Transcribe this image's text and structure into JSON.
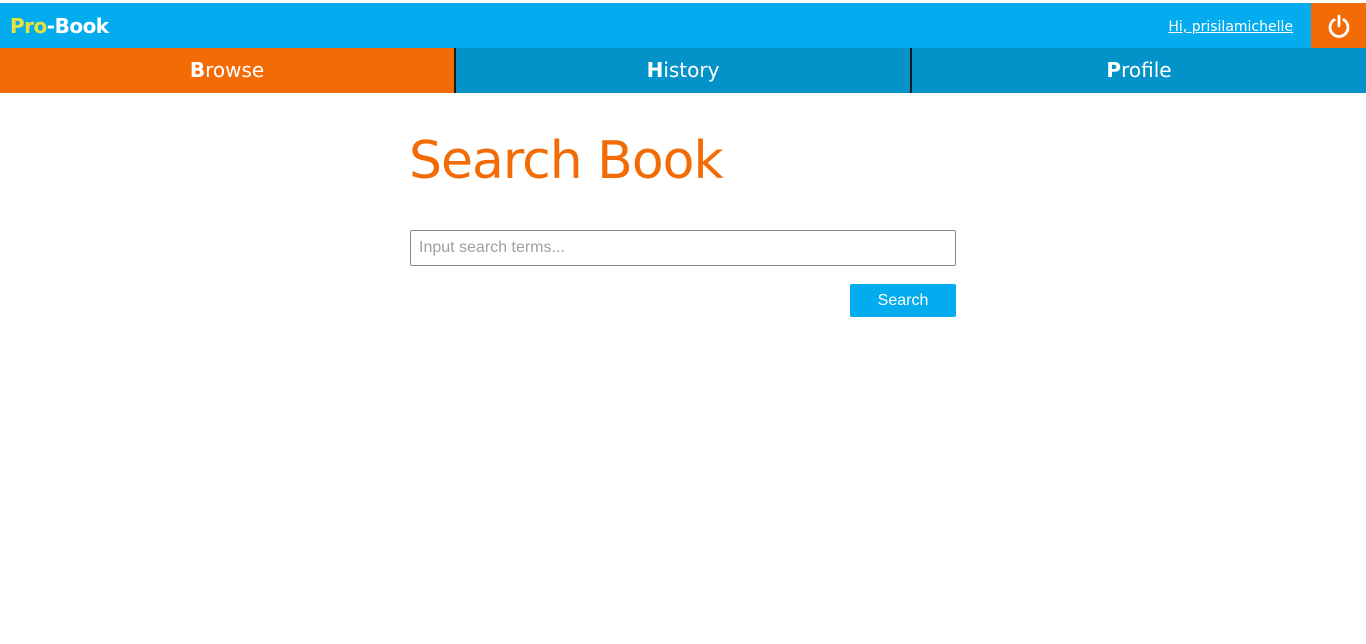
{
  "header": {
    "logo": {
      "pro": "Pro",
      "dash": "-",
      "book": "Book"
    },
    "greeting": "Hi, prisilamichelle",
    "logout_icon": "power-icon"
  },
  "nav": {
    "tabs": [
      {
        "initial": "B",
        "rest": "rowse",
        "active": true
      },
      {
        "initial": "H",
        "rest": "istory",
        "active": false
      },
      {
        "initial": "P",
        "rest": "rofile",
        "active": false
      }
    ]
  },
  "main": {
    "title": "Search Book",
    "search": {
      "placeholder": "Input search terms...",
      "value": ""
    },
    "search_button_label": "Search"
  },
  "colors": {
    "primary_blue": "#03acef",
    "nav_blue": "#0493c9",
    "accent_orange": "#f26b05",
    "logo_yellow": "#e6e23a"
  }
}
